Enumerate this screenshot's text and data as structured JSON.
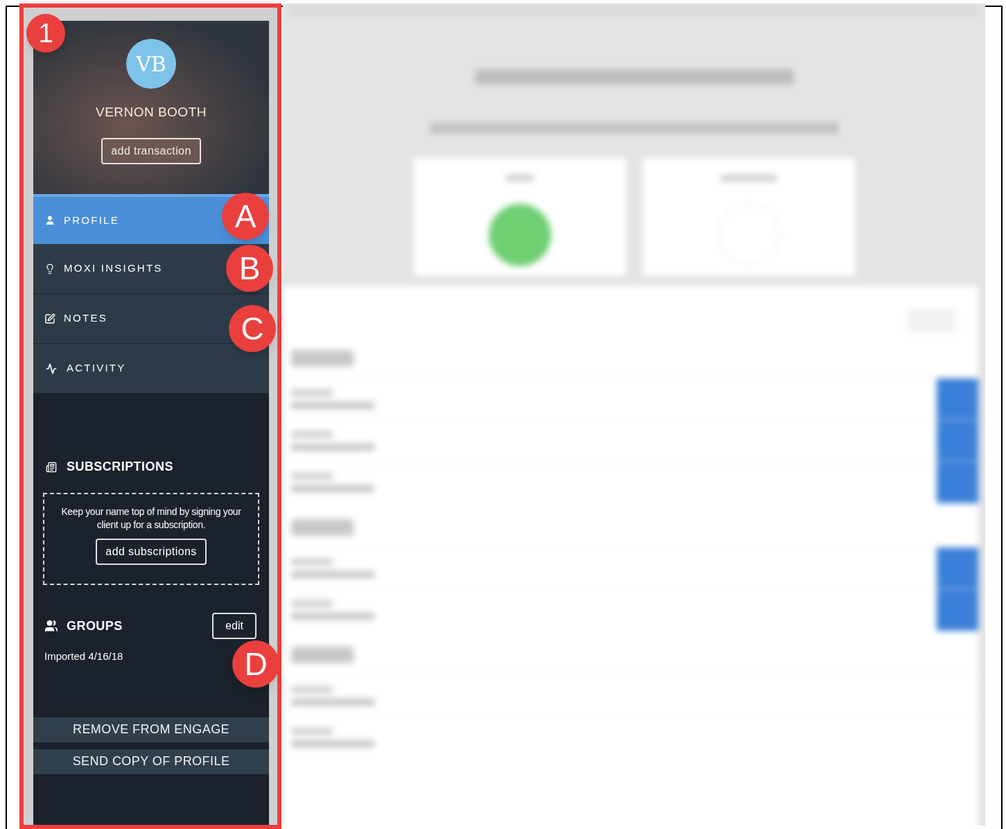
{
  "annotations": {
    "frame_number": "1",
    "badges": [
      "A",
      "B",
      "C",
      "D"
    ]
  },
  "profile": {
    "initials": "VB",
    "name": "VERNON BOOTH",
    "action": "add transaction"
  },
  "nav": [
    {
      "label": "PROFILE",
      "kind": "user",
      "selected": true
    },
    {
      "label": "MOXI INSIGHTS",
      "kind": "bulb",
      "selected": false
    },
    {
      "label": "NOTES",
      "kind": "notes",
      "selected": false
    },
    {
      "label": "ACTIVITY",
      "kind": "activity",
      "selected": false
    }
  ],
  "subscriptions": {
    "title": "SUBSCRIPTIONS",
    "message": "Keep your name top of mind by signing your client up for a subscription.",
    "button": "add subscriptions"
  },
  "groups": {
    "title": "GROUPS",
    "edit": "edit",
    "items": [
      "Imported 4/16/18"
    ]
  },
  "actions": [
    "REMOVE FROM ENGAGE",
    "SEND COPY OF PROFILE"
  ]
}
